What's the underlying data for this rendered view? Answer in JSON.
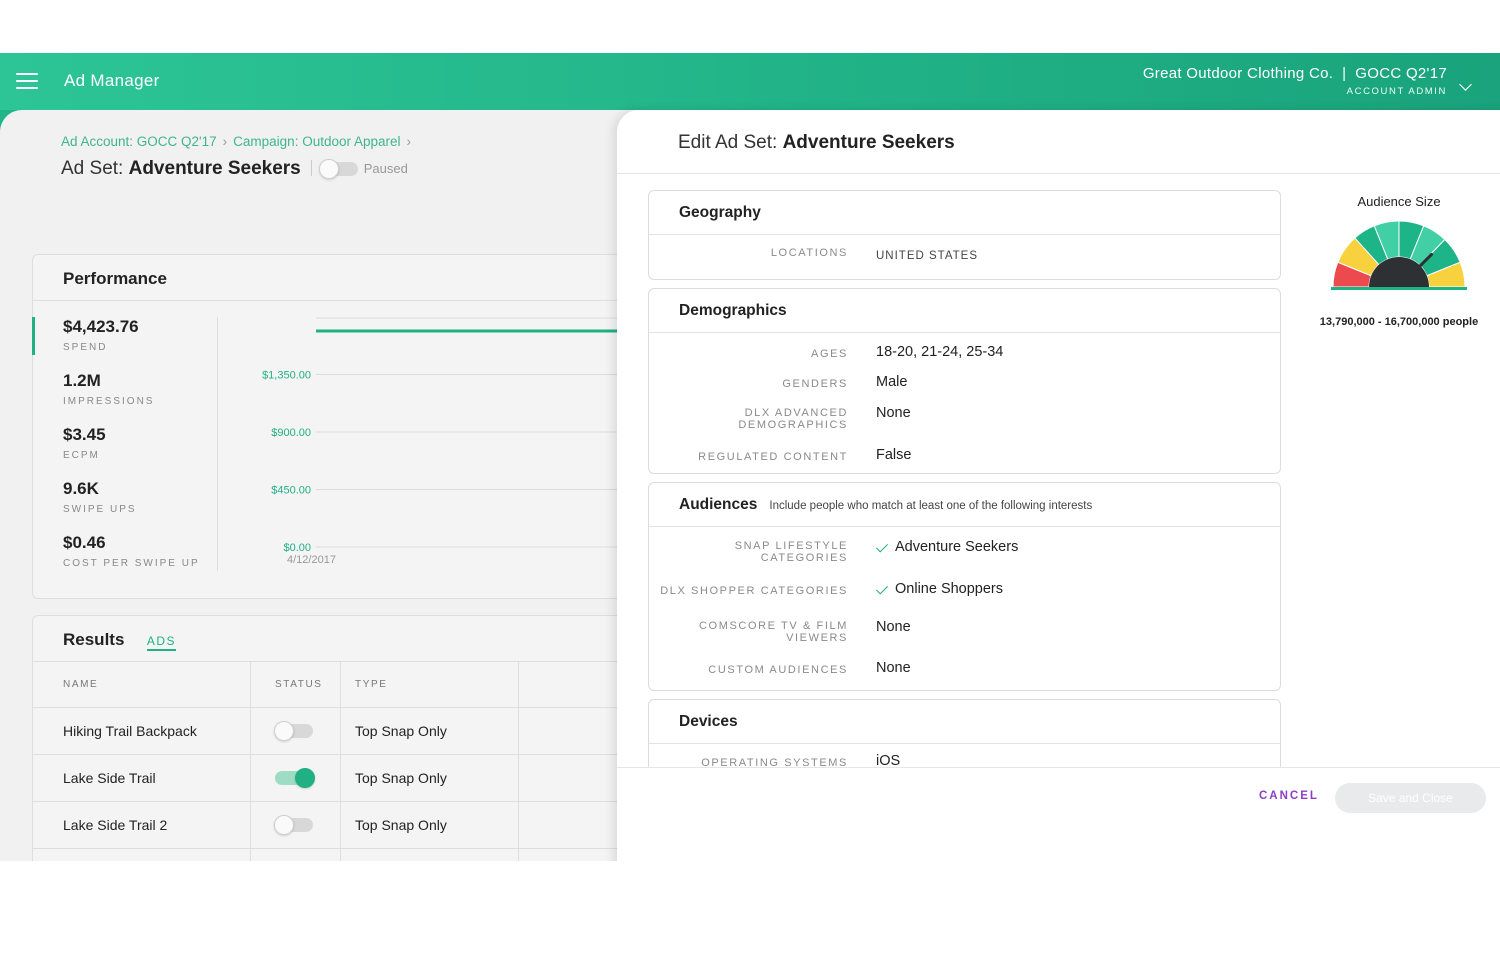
{
  "header": {
    "app_title": "Ad Manager",
    "account_name": "Great Outdoor Clothing Co.  |  GOCC Q2'17",
    "account_role": "ACCOUNT ADMIN"
  },
  "breadcrumb": {
    "account": "Ad Account: GOCC Q2'17",
    "campaign": "Campaign: Outdoor Apparel",
    "separator": "›"
  },
  "adset": {
    "prefix": "Ad Set: ",
    "name": "Adventure Seekers",
    "status": "Paused"
  },
  "performance": {
    "title": "Performance",
    "metrics": [
      {
        "value": "$4,423.76",
        "label": "SPEND"
      },
      {
        "value": "1.2M",
        "label": "IMPRESSIONS"
      },
      {
        "value": "$3.45",
        "label": "ECPM"
      },
      {
        "value": "9.6K",
        "label": "SWIPE UPS"
      },
      {
        "value": "$0.46",
        "label": "COST PER SWIPE UP"
      }
    ]
  },
  "chart_data": {
    "type": "line",
    "title": "",
    "xlabel": "",
    "ylabel": "",
    "x": [
      "4/12/2017"
    ],
    "y_ticks": [
      "$0.00",
      "$450.00",
      "$900.00",
      "$1,350.00"
    ],
    "ylim": [
      0,
      1800
    ],
    "series": [
      {
        "values": [
          1690
        ]
      }
    ],
    "grid": true,
    "colors": {
      "line": "#20b083",
      "tick_text": "#20b083",
      "grid": "#dcdcdc"
    }
  },
  "results": {
    "title": "Results",
    "tab": "ADS",
    "columns": [
      "NAME",
      "STATUS",
      "TYPE"
    ],
    "rows": [
      {
        "name": "Hiking Trail Backpack",
        "active": false,
        "type": "Top Snap Only"
      },
      {
        "name": "Lake Side Trail",
        "active": true,
        "type": "Top Snap Only"
      },
      {
        "name": "Lake Side Trail 2",
        "active": false,
        "type": "Top Snap Only"
      }
    ]
  },
  "edit": {
    "prefix": "Edit Ad Set: ",
    "name": "Adventure Seekers",
    "sections": {
      "geography": {
        "title": "Geography",
        "fields": [
          {
            "label": "LOCATIONS",
            "value": "UNITED STATES"
          }
        ]
      },
      "demographics": {
        "title": "Demographics",
        "fields": [
          {
            "label": "AGES",
            "value": "18-20, 21-24, 25-34"
          },
          {
            "label": "GENDERS",
            "value": "Male"
          },
          {
            "label": "DLX ADVANCED DEMOGRAPHICS",
            "value": "None"
          },
          {
            "label": "REGULATED CONTENT",
            "value": "False"
          }
        ]
      },
      "audiences": {
        "title": "Audiences",
        "subtitle": "Include people who match at least one of the following interests",
        "fields": [
          {
            "label": "SNAP LIFESTYLE CATEGORIES",
            "value": "Adventure Seekers"
          },
          {
            "label": "DLX SHOPPER CATEGORIES",
            "value": "Online Shoppers"
          },
          {
            "label": "COMSCORE TV & FILM VIEWERS",
            "value": "None"
          },
          {
            "label": "CUSTOM AUDIENCES",
            "value": "None"
          }
        ]
      },
      "devices": {
        "title": "Devices",
        "fields": [
          {
            "label": "OPERATING SYSTEMS",
            "value": "iOS"
          }
        ]
      }
    }
  },
  "audience_size": {
    "title": "Audience Size",
    "range": "13,790,000 - 16,700,000 people",
    "gauge_level": 0.75,
    "colors": {
      "red": "#ec4a4f",
      "yellow": "#f7d23e",
      "green": "#1db487",
      "teal": "#43cfa6",
      "center": "#2e3133"
    }
  },
  "footer": {
    "cancel": "CANCEL",
    "save": "Save and Close"
  },
  "icons": [
    "menu-icon",
    "chevron-down-icon",
    "chevron-right-icon",
    "check-icon",
    "gauge-icon"
  ]
}
